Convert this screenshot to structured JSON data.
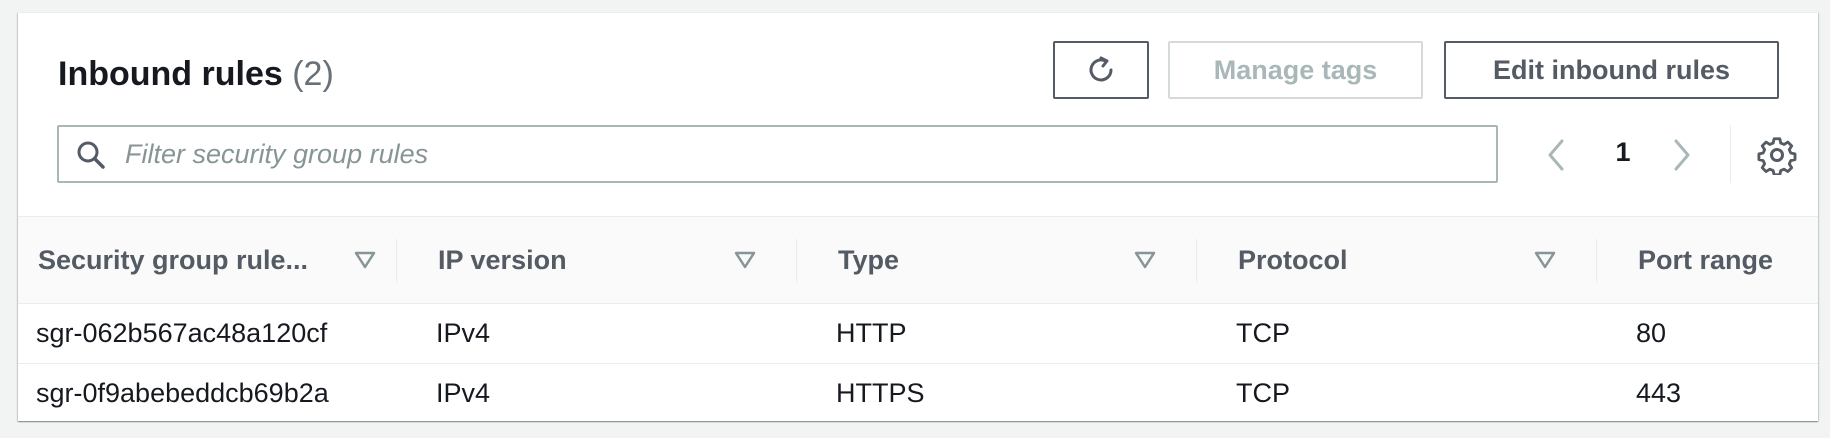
{
  "header": {
    "title": "Inbound rules",
    "count": "(2)"
  },
  "toolbar": {
    "refresh_icon": "refresh-icon",
    "manage_tags_label": "Manage tags",
    "edit_label": "Edit inbound rules"
  },
  "search": {
    "placeholder": "Filter security group rules",
    "value": ""
  },
  "pagination": {
    "current_page": "1"
  },
  "table": {
    "columns": [
      {
        "label": "Security group rule..."
      },
      {
        "label": "IP version"
      },
      {
        "label": "Type"
      },
      {
        "label": "Protocol"
      },
      {
        "label": "Port range"
      }
    ],
    "rows": [
      {
        "rule_id": "sgr-062b567ac48a120cf",
        "ip_version": "IPv4",
        "type": "HTTP",
        "protocol": "TCP",
        "port_range": "80"
      },
      {
        "rule_id": "sgr-0f9abebeddcb69b2a",
        "ip_version": "IPv4",
        "type": "HTTPS",
        "protocol": "TCP",
        "port_range": "443"
      }
    ]
  },
  "colors": {
    "text_primary": "#16191f",
    "text_secondary": "#545b64",
    "text_muted": "#687078",
    "border": "#eaeded",
    "disabled": "#aab7b8",
    "page_bg": "#f2f3f3"
  }
}
